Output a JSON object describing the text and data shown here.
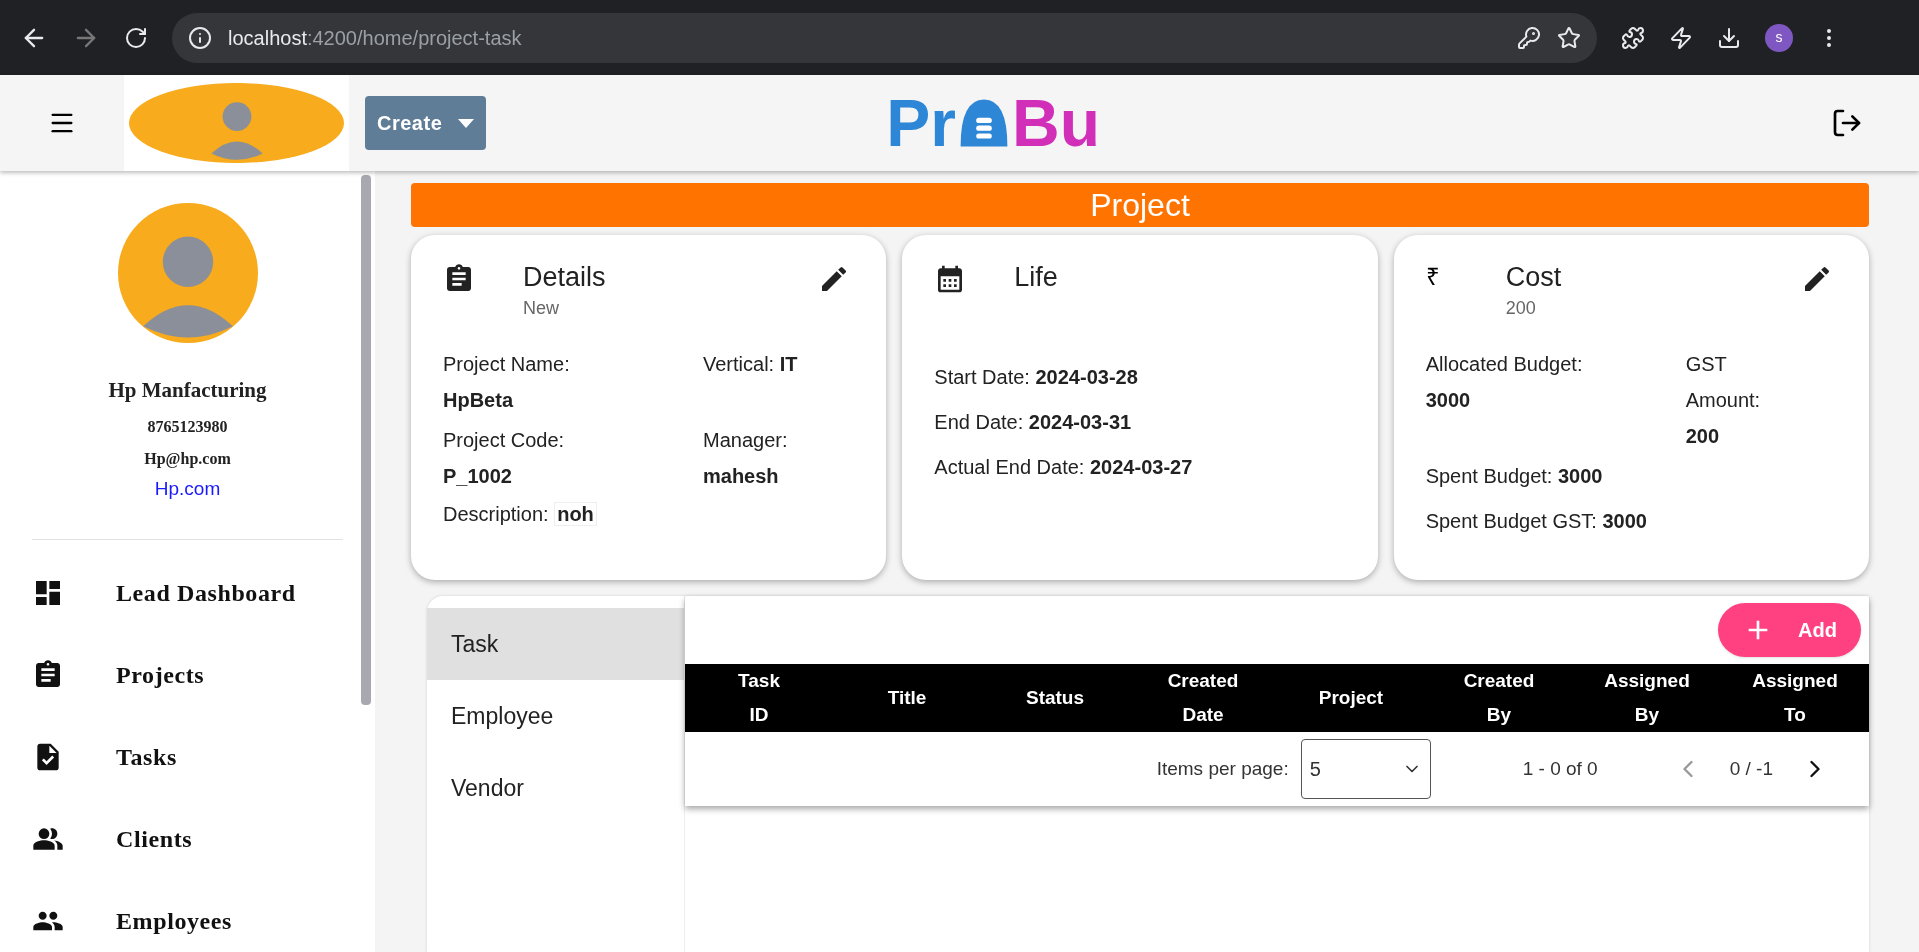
{
  "browser": {
    "url_host": "localhost",
    "url_rest": ":4200/home/project-task",
    "profile_initial": "s",
    "forward_disabled": true
  },
  "header": {
    "create_label": "Create",
    "logo_left": "Pr",
    "logo_right": "Bu"
  },
  "sidebar": {
    "name": "Hp Manfacturing",
    "phone": "8765123980",
    "email": "Hp@hp.com",
    "website": "Hp.com",
    "items": [
      {
        "label": "Lead Dashboard",
        "kind": "dashboard"
      },
      {
        "label": "Projects",
        "kind": "clipboard"
      },
      {
        "label": "Tasks",
        "kind": "task"
      },
      {
        "label": "Clients",
        "kind": "clients"
      },
      {
        "label": "Employees",
        "kind": "people"
      }
    ]
  },
  "banner": "Project",
  "cards": [
    {
      "kind": "details",
      "title": "Details",
      "subtitle": "New",
      "editable": true,
      "fields": [
        {
          "label": "Project Name:",
          "value": "HpBeta"
        },
        {
          "label": "Vertical:",
          "value": "IT"
        },
        {
          "label": "Project Code:",
          "value": "P_1002"
        },
        {
          "label": "Manager:",
          "value": "mahesh"
        }
      ],
      "footer": {
        "label": "Description:",
        "value": "noh"
      }
    },
    {
      "kind": "life",
      "title": "Life",
      "editable": false,
      "lines": [
        {
          "label": "Start Date:",
          "value": "2024-03-28"
        },
        {
          "label": "End Date:",
          "value": "2024-03-31"
        },
        {
          "label": "Actual End Date:",
          "value": "2024-03-27"
        }
      ]
    },
    {
      "kind": "cost",
      "title": "Cost",
      "subtitle": "200",
      "symbol": "₹",
      "editable": true,
      "fields": [
        {
          "label": "Allocated Budget:",
          "value": "3000"
        },
        {
          "label": "GST Amount:",
          "value": "200"
        }
      ],
      "lines": [
        {
          "label": "Spent Budget:",
          "value": "3000"
        },
        {
          "label": "Spent Budget GST:",
          "value": "3000"
        }
      ]
    }
  ],
  "tabs": [
    {
      "label": "Task",
      "selected": true
    },
    {
      "label": "Employee",
      "selected": false
    },
    {
      "label": "Vendor",
      "selected": false
    }
  ],
  "table": {
    "add_label": "Add",
    "columns": [
      [
        "Task",
        "ID"
      ],
      [
        "Title"
      ],
      [
        "Status"
      ],
      [
        "Created",
        "Date"
      ],
      [
        "Project"
      ],
      [
        "Created",
        "By"
      ],
      [
        "Assigned",
        "By"
      ],
      [
        "Assigned",
        "To"
      ]
    ],
    "paginator": {
      "items_label": "Items per page:",
      "page_size": "5",
      "range": "1 - 0 of 0",
      "page": "0 / -1",
      "prev_disabled": true,
      "next_disabled": false
    }
  }
}
